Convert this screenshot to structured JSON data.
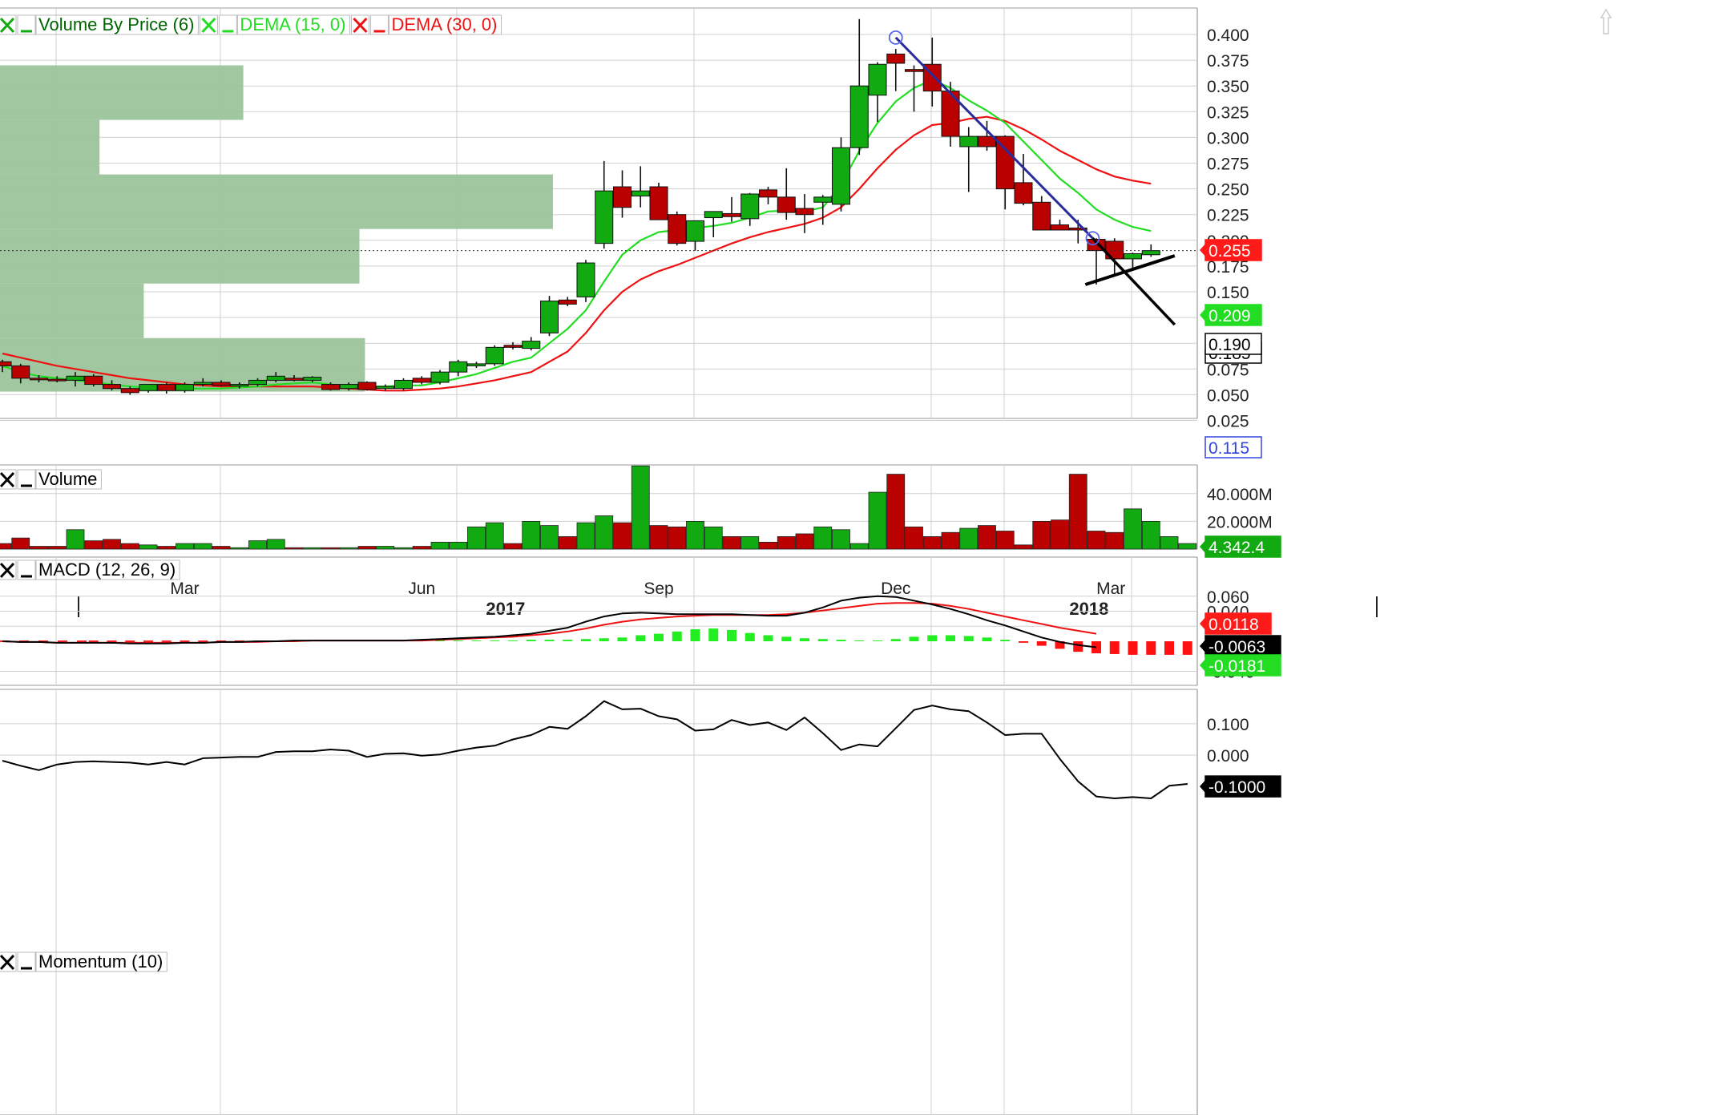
{
  "x_axis": {
    "month_labels": [
      {
        "label": "Mar",
        "index": 10
      },
      {
        "label": "Jun",
        "index": 23
      },
      {
        "label": "Sep",
        "index": 36
      },
      {
        "label": "Dec",
        "index": 49
      },
      {
        "label": "Mar",
        "index": 60.8
      }
    ],
    "year_labels": [
      {
        "label": "2017",
        "index": 27.6
      },
      {
        "label": "2018",
        "index": 59.6
      }
    ]
  },
  "legends": {
    "price": [
      {
        "text": "Volume By Price (6)",
        "color": "#006400",
        "x_color": "#11aa11"
      },
      {
        "text": "DEMA (15, 0)",
        "color": "#22dd22",
        "x_color": "#22dd22"
      },
      {
        "text": "DEMA (30, 0)",
        "color": "#ee1111",
        "x_color": "#ee1111"
      }
    ],
    "volume": "Volume",
    "macd": "MACD (12, 26, 9)",
    "momentum": "Momentum (10)"
  },
  "price_tags": {
    "dema30": "0.255",
    "dema15": "0.209",
    "last": "0.190",
    "trend": "0.115",
    "hidden_last": "0.185"
  },
  "volume_tag": "4.342.4",
  "macd_tags": {
    "signal": "0.0118",
    "macd": "-0.0063",
    "hist": "-0.0181"
  },
  "momentum_tag": "-0.1000",
  "colors": {
    "up": "#11aa11",
    "down": "#bb0000",
    "dema15": "#22dd22",
    "dema30": "#ee1111",
    "vbp": "#9bc49b",
    "trend": "#2b2b9a",
    "grid": "#d0d0d0"
  },
  "chart_data": [
    {
      "type": "candlestick",
      "title": "Volume By Price (6)",
      "y_ticks": [
        "0.025",
        "0.050",
        "0.075",
        "0.100",
        "0.125",
        "0.150",
        "0.175",
        "0.200",
        "0.225",
        "0.250",
        "0.275",
        "0.300",
        "0.325",
        "0.350",
        "0.375",
        "0.400"
      ],
      "ylim": [
        0.025,
        0.4
      ],
      "candles": [
        {
          "o": 0.082,
          "h": 0.084,
          "l": 0.072,
          "c": 0.078
        },
        {
          "o": 0.078,
          "h": 0.08,
          "l": 0.061,
          "c": 0.066
        },
        {
          "o": 0.066,
          "h": 0.069,
          "l": 0.062,
          "c": 0.065
        },
        {
          "o": 0.065,
          "h": 0.068,
          "l": 0.062,
          "c": 0.064
        },
        {
          "o": 0.064,
          "h": 0.072,
          "l": 0.058,
          "c": 0.068
        },
        {
          "o": 0.068,
          "h": 0.07,
          "l": 0.058,
          "c": 0.06
        },
        {
          "o": 0.06,
          "h": 0.064,
          "l": 0.054,
          "c": 0.056
        },
        {
          "o": 0.056,
          "h": 0.058,
          "l": 0.05,
          "c": 0.052
        },
        {
          "o": 0.054,
          "h": 0.06,
          "l": 0.052,
          "c": 0.06
        },
        {
          "o": 0.06,
          "h": 0.062,
          "l": 0.051,
          "c": 0.054
        },
        {
          "o": 0.054,
          "h": 0.062,
          "l": 0.052,
          "c": 0.06
        },
        {
          "o": 0.06,
          "h": 0.066,
          "l": 0.058,
          "c": 0.062
        },
        {
          "o": 0.062,
          "h": 0.064,
          "l": 0.058,
          "c": 0.059
        },
        {
          "o": 0.059,
          "h": 0.062,
          "l": 0.056,
          "c": 0.06
        },
        {
          "o": 0.06,
          "h": 0.066,
          "l": 0.058,
          "c": 0.064
        },
        {
          "o": 0.064,
          "h": 0.072,
          "l": 0.062,
          "c": 0.068
        },
        {
          "o": 0.066,
          "h": 0.069,
          "l": 0.063,
          "c": 0.064
        },
        {
          "o": 0.064,
          "h": 0.068,
          "l": 0.062,
          "c": 0.067
        },
        {
          "o": 0.06,
          "h": 0.062,
          "l": 0.054,
          "c": 0.055
        },
        {
          "o": 0.056,
          "h": 0.062,
          "l": 0.054,
          "c": 0.06
        },
        {
          "o": 0.062,
          "h": 0.063,
          "l": 0.054,
          "c": 0.055
        },
        {
          "o": 0.056,
          "h": 0.06,
          "l": 0.054,
          "c": 0.058
        },
        {
          "o": 0.056,
          "h": 0.066,
          "l": 0.054,
          "c": 0.064
        },
        {
          "o": 0.066,
          "h": 0.068,
          "l": 0.06,
          "c": 0.062
        },
        {
          "o": 0.062,
          "h": 0.074,
          "l": 0.06,
          "c": 0.072
        },
        {
          "o": 0.072,
          "h": 0.084,
          "l": 0.068,
          "c": 0.082
        },
        {
          "o": 0.078,
          "h": 0.082,
          "l": 0.076,
          "c": 0.08
        },
        {
          "o": 0.08,
          "h": 0.098,
          "l": 0.078,
          "c": 0.096
        },
        {
          "o": 0.098,
          "h": 0.101,
          "l": 0.094,
          "c": 0.096
        },
        {
          "o": 0.095,
          "h": 0.106,
          "l": 0.093,
          "c": 0.102
        },
        {
          "o": 0.11,
          "h": 0.146,
          "l": 0.107,
          "c": 0.141
        },
        {
          "o": 0.142,
          "h": 0.145,
          "l": 0.136,
          "c": 0.138
        },
        {
          "o": 0.145,
          "h": 0.181,
          "l": 0.14,
          "c": 0.178
        },
        {
          "o": 0.197,
          "h": 0.277,
          "l": 0.192,
          "c": 0.248
        },
        {
          "o": 0.252,
          "h": 0.268,
          "l": 0.222,
          "c": 0.232
        },
        {
          "o": 0.243,
          "h": 0.272,
          "l": 0.232,
          "c": 0.248
        },
        {
          "o": 0.252,
          "h": 0.256,
          "l": 0.22,
          "c": 0.22
        },
        {
          "o": 0.225,
          "h": 0.228,
          "l": 0.195,
          "c": 0.197
        },
        {
          "o": 0.199,
          "h": 0.216,
          "l": 0.19,
          "c": 0.219
        },
        {
          "o": 0.222,
          "h": 0.228,
          "l": 0.203,
          "c": 0.228
        },
        {
          "o": 0.226,
          "h": 0.242,
          "l": 0.218,
          "c": 0.223
        },
        {
          "o": 0.221,
          "h": 0.246,
          "l": 0.214,
          "c": 0.245
        },
        {
          "o": 0.249,
          "h": 0.252,
          "l": 0.235,
          "c": 0.242
        },
        {
          "o": 0.242,
          "h": 0.27,
          "l": 0.22,
          "c": 0.227
        },
        {
          "o": 0.231,
          "h": 0.245,
          "l": 0.207,
          "c": 0.225
        },
        {
          "o": 0.237,
          "h": 0.244,
          "l": 0.215,
          "c": 0.242
        },
        {
          "o": 0.235,
          "h": 0.3,
          "l": 0.228,
          "c": 0.29
        },
        {
          "o": 0.29,
          "h": 0.415,
          "l": 0.283,
          "c": 0.35
        },
        {
          "o": 0.341,
          "h": 0.373,
          "l": 0.315,
          "c": 0.371
        },
        {
          "o": 0.381,
          "h": 0.386,
          "l": 0.345,
          "c": 0.372
        },
        {
          "o": 0.366,
          "h": 0.37,
          "l": 0.325,
          "c": 0.364
        },
        {
          "o": 0.371,
          "h": 0.397,
          "l": 0.33,
          "c": 0.345
        },
        {
          "o": 0.345,
          "h": 0.354,
          "l": 0.291,
          "c": 0.301
        },
        {
          "o": 0.291,
          "h": 0.31,
          "l": 0.247,
          "c": 0.301
        },
        {
          "o": 0.301,
          "h": 0.316,
          "l": 0.287,
          "c": 0.291
        },
        {
          "o": 0.301,
          "h": 0.302,
          "l": 0.23,
          "c": 0.25
        },
        {
          "o": 0.256,
          "h": 0.284,
          "l": 0.234,
          "c": 0.236
        },
        {
          "o": 0.237,
          "h": 0.243,
          "l": 0.21,
          "c": 0.21
        },
        {
          "o": 0.215,
          "h": 0.22,
          "l": 0.21,
          "c": 0.21
        },
        {
          "o": 0.212,
          "h": 0.22,
          "l": 0.197,
          "c": 0.21
        },
        {
          "o": 0.201,
          "h": 0.202,
          "l": 0.157,
          "c": 0.19
        },
        {
          "o": 0.199,
          "h": 0.202,
          "l": 0.166,
          "c": 0.182
        },
        {
          "o": 0.182,
          "h": 0.188,
          "l": 0.172,
          "c": 0.187
        },
        {
          "o": 0.186,
          "h": 0.196,
          "l": 0.184,
          "c": 0.19
        }
      ],
      "dema15": [
        0.078,
        0.072,
        0.068,
        0.066,
        0.064,
        0.062,
        0.06,
        0.058,
        0.057,
        0.056,
        0.056,
        0.056,
        0.056,
        0.057,
        0.058,
        0.06,
        0.061,
        0.062,
        0.06,
        0.059,
        0.058,
        0.058,
        0.059,
        0.059,
        0.062,
        0.066,
        0.07,
        0.076,
        0.082,
        0.086,
        0.1,
        0.114,
        0.132,
        0.16,
        0.186,
        0.2,
        0.208,
        0.21,
        0.212,
        0.214,
        0.217,
        0.222,
        0.228,
        0.229,
        0.228,
        0.232,
        0.254,
        0.287,
        0.314,
        0.335,
        0.348,
        0.356,
        0.348,
        0.336,
        0.326,
        0.314,
        0.296,
        0.278,
        0.26,
        0.246,
        0.23,
        0.22,
        0.213,
        0.209
      ],
      "dema30": [
        0.09,
        0.086,
        0.082,
        0.078,
        0.075,
        0.072,
        0.069,
        0.066,
        0.064,
        0.062,
        0.06,
        0.059,
        0.058,
        0.058,
        0.058,
        0.058,
        0.058,
        0.058,
        0.057,
        0.056,
        0.055,
        0.054,
        0.054,
        0.055,
        0.056,
        0.058,
        0.061,
        0.064,
        0.068,
        0.072,
        0.082,
        0.092,
        0.11,
        0.132,
        0.15,
        0.162,
        0.17,
        0.176,
        0.183,
        0.19,
        0.197,
        0.203,
        0.208,
        0.212,
        0.216,
        0.222,
        0.232,
        0.25,
        0.27,
        0.288,
        0.302,
        0.312,
        0.314,
        0.318,
        0.32,
        0.316,
        0.308,
        0.298,
        0.287,
        0.278,
        0.269,
        0.262,
        0.258,
        0.255
      ],
      "series": [
        {
          "name": "DEMA (15, 0)",
          "last": 0.209
        },
        {
          "name": "DEMA (30, 0)",
          "last": 0.255
        }
      ],
      "volume_by_price": [
        {
          "low": 0.053,
          "high": 0.105,
          "rel": 0.66
        },
        {
          "low": 0.105,
          "high": 0.158,
          "rel": 0.26
        },
        {
          "low": 0.158,
          "high": 0.211,
          "rel": 0.65
        },
        {
          "low": 0.211,
          "high": 0.264,
          "rel": 1.0
        },
        {
          "low": 0.264,
          "high": 0.317,
          "rel": 0.18
        },
        {
          "low": 0.317,
          "high": 0.37,
          "rel": 0.44
        }
      ],
      "trendlines": [
        {
          "from": [
            49.0,
            0.397
          ],
          "to": [
            59.8,
            0.202
          ],
          "extend_to": [
            64.3,
            0.118
          ],
          "color": "#2b2b9a"
        },
        {
          "from": [
            59.4,
            0.157
          ],
          "to": [
            64.3,
            0.185
          ],
          "color": "#000000"
        }
      ]
    },
    {
      "type": "bar",
      "title": "Volume",
      "y_ticks": [
        "20.000M",
        "40.000M"
      ],
      "ylim": [
        0,
        60000000
      ],
      "values": [
        4,
        8,
        2,
        2,
        14,
        6,
        7,
        4,
        3,
        2,
        4,
        4,
        2,
        1,
        6,
        7,
        1,
        1,
        1,
        1,
        2,
        2,
        1,
        2,
        5,
        5,
        16,
        19,
        4,
        20,
        17,
        9,
        19,
        24,
        19,
        60,
        17,
        16,
        20,
        16,
        9,
        9,
        5,
        9,
        11,
        16,
        14,
        4,
        41,
        54,
        16,
        9,
        12,
        15,
        17,
        13,
        3,
        20,
        21,
        54,
        13,
        12,
        29,
        20,
        9,
        4
      ],
      "value_unit": "M",
      "last": "4.342.4"
    },
    {
      "type": "line",
      "title": "MACD (12, 26, 9)",
      "y_ticks": [
        "-0.040",
        "0.020",
        "0.040",
        "0.060"
      ],
      "ylim": [
        -0.045,
        0.068
      ],
      "macd": [
        0.0,
        -0.001,
        -0.001,
        -0.002,
        -0.002,
        -0.002,
        -0.002,
        -0.003,
        -0.003,
        -0.003,
        -0.002,
        -0.002,
        -0.001,
        -0.001,
        0.0,
        0.0,
        0.001,
        0.001,
        0.001,
        0.001,
        0.001,
        0.001,
        0.001,
        0.002,
        0.003,
        0.004,
        0.005,
        0.006,
        0.008,
        0.01,
        0.014,
        0.018,
        0.026,
        0.033,
        0.037,
        0.038,
        0.037,
        0.036,
        0.036,
        0.036,
        0.036,
        0.035,
        0.034,
        0.034,
        0.038,
        0.045,
        0.054,
        0.058,
        0.06,
        0.059,
        0.054,
        0.049,
        0.043,
        0.036,
        0.028,
        0.021,
        0.013,
        0.005,
        -0.001,
        -0.005,
        -0.008
      ],
      "signal": [
        0.0,
        -0.001,
        -0.001,
        -0.002,
        -0.002,
        -0.002,
        -0.002,
        -0.002,
        -0.002,
        -0.002,
        -0.002,
        -0.002,
        -0.001,
        -0.001,
        -0.001,
        0.0,
        0.0,
        0.001,
        0.001,
        0.001,
        0.001,
        0.001,
        0.001,
        0.001,
        0.002,
        0.003,
        0.004,
        0.005,
        0.006,
        0.008,
        0.01,
        0.013,
        0.017,
        0.022,
        0.026,
        0.029,
        0.031,
        0.033,
        0.034,
        0.035,
        0.035,
        0.035,
        0.035,
        0.036,
        0.038,
        0.041,
        0.044,
        0.047,
        0.05,
        0.051,
        0.051,
        0.05,
        0.047,
        0.043,
        0.038,
        0.033,
        0.028,
        0.023,
        0.018,
        0.014,
        0.01
      ],
      "histogram": [
        0.0,
        0.0,
        0.0,
        0.0,
        0.0,
        0.0,
        0.0,
        0.0,
        0.0,
        0.0,
        0.001,
        0.001,
        0.001,
        0.001,
        0.001,
        0.001,
        0.001,
        0.001,
        0.001,
        0.001,
        0.001,
        0.001,
        0.001,
        0.001,
        0.002,
        0.002,
        0.002,
        0.003,
        0.004,
        0.005,
        0.008,
        0.01,
        0.013,
        0.016,
        0.017,
        0.015,
        0.011,
        0.008,
        0.006,
        0.004,
        0.003,
        0.002,
        0.001,
        0.001,
        0.003,
        0.006,
        0.008,
        0.008,
        0.007,
        0.005,
        0.002,
        -0.002,
        -0.006,
        -0.01,
        -0.014,
        -0.016,
        -0.017,
        -0.018,
        -0.018,
        -0.018,
        -0.018
      ],
      "last": {
        "signal": 0.0118,
        "macd": -0.0063,
        "hist": -0.0181
      }
    },
    {
      "type": "line",
      "title": "Momentum (10)",
      "y_ticks": [
        "0.000",
        "0.100"
      ],
      "ylim": [
        -0.17,
        0.19
      ],
      "values": [
        -0.018,
        -0.034,
        -0.048,
        -0.03,
        -0.022,
        -0.02,
        -0.022,
        -0.024,
        -0.03,
        -0.022,
        -0.03,
        -0.01,
        -0.008,
        -0.006,
        -0.006,
        0.01,
        0.012,
        0.012,
        0.018,
        0.014,
        -0.006,
        0.004,
        0.006,
        -0.002,
        0.002,
        0.014,
        0.024,
        0.03,
        0.05,
        0.064,
        0.09,
        0.084,
        0.124,
        0.172,
        0.146,
        0.148,
        0.124,
        0.114,
        0.078,
        0.082,
        0.112,
        0.096,
        0.104,
        0.08,
        0.12,
        0.07,
        0.016,
        0.034,
        0.028,
        0.086,
        0.144,
        0.158,
        0.146,
        0.14,
        0.104,
        0.064,
        0.068,
        0.068,
        -0.012,
        -0.084,
        -0.132,
        -0.138,
        -0.134,
        -0.138,
        -0.098,
        -0.092
      ],
      "last": -0.1
    }
  ]
}
